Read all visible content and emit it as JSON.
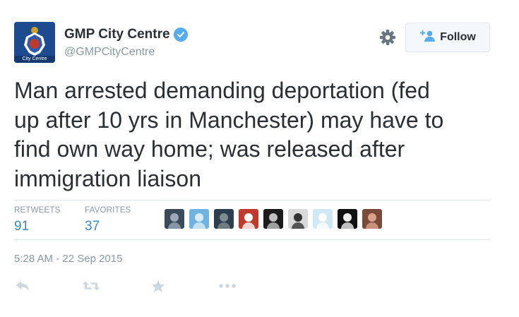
{
  "account": {
    "name": "GMP City Centre",
    "handle": "@GMPCityCentre",
    "avatar_caption": "City Centre",
    "verified_icon": "verified-badge-icon"
  },
  "header": {
    "follow_label": "Follow",
    "settings_icon": "gear-icon",
    "follow_icon": "add-user-icon"
  },
  "tweet": {
    "lines": [
      "Man arrested demanding deportation (fed",
      "up after 10 yrs in Manchester) may have to",
      "find own way home; was released after",
      "immigration liaison"
    ],
    "timestamp": "5:28 AM - 22 Sep 2015"
  },
  "stats": {
    "retweets_label": "RETWEETS",
    "retweets_value": "91",
    "favorites_label": "FAVORITES",
    "favorites_value": "37"
  },
  "favoriters": [
    {
      "bg": "#3a4a5a",
      "fg": "#9aa8b8"
    },
    {
      "bg": "#6fb3e0",
      "fg": "#d8ecf8"
    },
    {
      "bg": "#2c3e50",
      "fg": "#7f8c8d"
    },
    {
      "bg": "#c0392b",
      "fg": "#ffffff"
    },
    {
      "bg": "#1b1b1b",
      "fg": "#c0c0c0"
    },
    {
      "bg": "#d9d9d9",
      "fg": "#333333"
    },
    {
      "bg": "#cfe8f5",
      "fg": "#ffffff"
    },
    {
      "bg": "#111111",
      "fg": "#eeeeee"
    },
    {
      "bg": "#7a4a3a",
      "fg": "#d9a18a"
    }
  ],
  "actions": [
    "reply-icon",
    "retweet-icon",
    "favorite-icon",
    "more-icon"
  ],
  "colors": {
    "text": "#292f33",
    "muted": "#8899a6",
    "link": "#3b88c3",
    "verified": "#55acee",
    "avatar": "#1e4a8f"
  }
}
